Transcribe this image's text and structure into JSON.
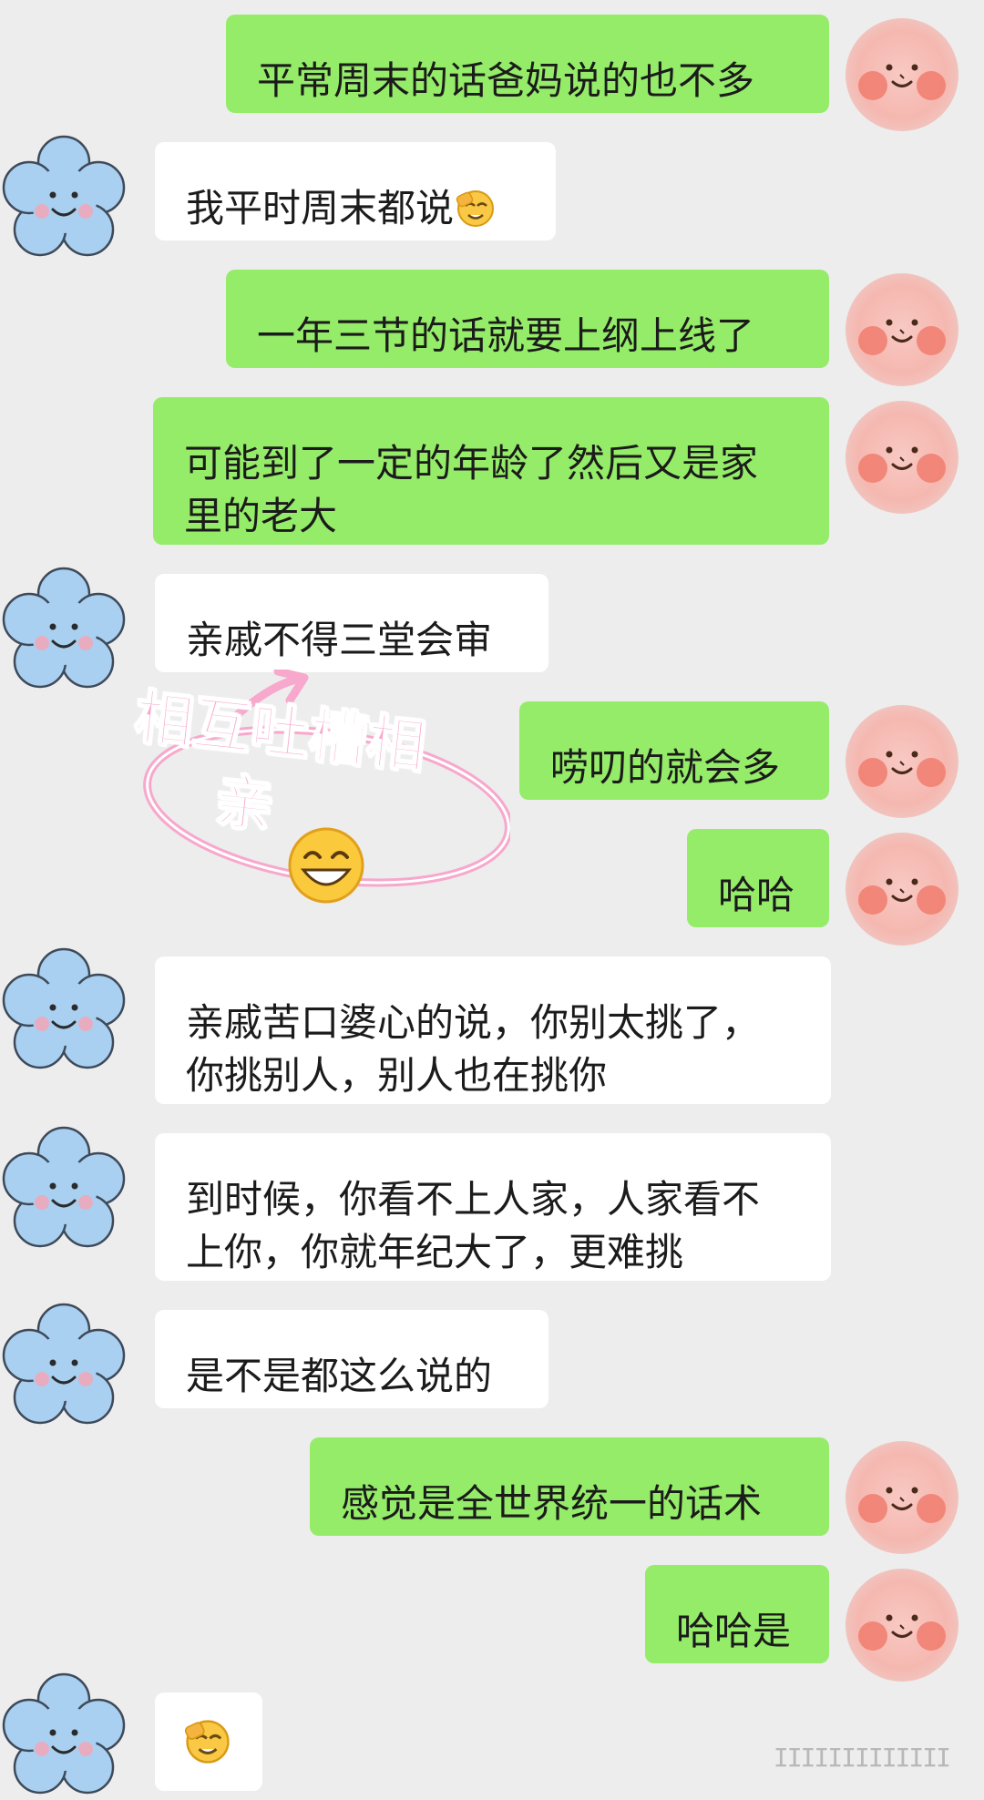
{
  "messages": [
    {
      "side": "sent",
      "text": "平常周末的话爸妈说的也不多"
    },
    {
      "side": "recv",
      "text": "我平时周末都说",
      "emoji": "facepalm-emoji"
    },
    {
      "side": "sent",
      "text": "一年三节的话就要上纲上线了"
    },
    {
      "side": "sent",
      "text_lines": [
        "可能到了一定的年龄了然后又是家",
        "里的老大"
      ]
    },
    {
      "side": "recv",
      "text": "亲戚不得三堂会审"
    },
    {
      "side": "sent",
      "text": "唠叨的就会多"
    },
    {
      "side": "sent",
      "text": "哈哈"
    },
    {
      "side": "recv",
      "text_lines": [
        "亲戚苦口婆心的说，你别太挑了，",
        "你挑别人，别人也在挑你"
      ]
    },
    {
      "side": "recv",
      "text_lines": [
        "到时候，你看不上人家，人家看不",
        "上你，你就年纪大了，更难挑"
      ]
    },
    {
      "side": "recv",
      "text": "是不是都这么说的"
    },
    {
      "side": "sent",
      "text": "感觉是全世界统一的话术"
    },
    {
      "side": "sent",
      "text": "哈哈是"
    },
    {
      "side": "recv",
      "emoji": "facepalm-emoji"
    }
  ],
  "sticker": {
    "line1": "相互吐槽相",
    "line2": "亲",
    "emoji": "grinning-face-emoji",
    "colors": {
      "text": "#f7a8cc",
      "ring": "#f7a8cc"
    }
  },
  "watermark": "IIIIIIIIIIIII",
  "colors": {
    "background": "#ededed",
    "sent_bubble": "#95ec69",
    "recv_bubble": "#ffffff",
    "pink_avatar": "#f4a6a0",
    "blue_avatar": "#a9d0f0"
  }
}
